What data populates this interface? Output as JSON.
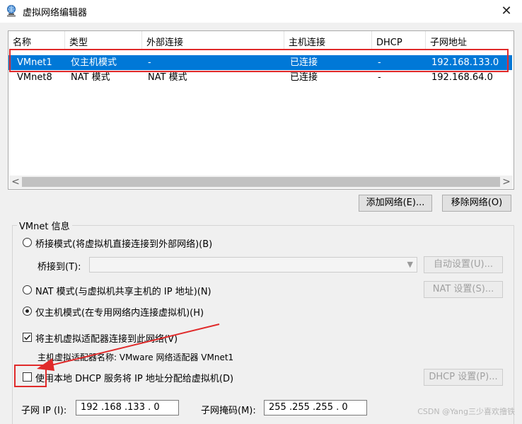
{
  "window": {
    "title": "虚拟网络编辑器",
    "close_glyph": "✕"
  },
  "table": {
    "columns": [
      "名称",
      "类型",
      "外部连接",
      "主机连接",
      "DHCP",
      "子网地址"
    ],
    "rows": [
      [
        "VMnet1",
        "仅主机模式",
        "-",
        "已连接",
        "-",
        "192.168.133.0"
      ],
      [
        "VMnet8",
        "NAT 模式",
        "NAT 模式",
        "已连接",
        "-",
        "192.168.64.0"
      ]
    ],
    "selected_row": 0,
    "scroll_left": "<",
    "scroll_right": ">"
  },
  "buttons": {
    "add_network": "添加网络(E)...",
    "remove_network": "移除网络(O)"
  },
  "vmnet_info": {
    "group_title": "VMnet 信息",
    "bridged_label": "桥接模式(将虚拟机直接连接到外部网络)(B)",
    "bridged_to_label": "桥接到(T):",
    "bridged_to_value": "",
    "auto_settings": "自动设置(U)...",
    "nat_label": "NAT 模式(与虚拟机共享主机的 IP 地址)(N)",
    "nat_settings": "NAT 设置(S)...",
    "hostonly_label": "仅主机模式(在专用网络内连接虚拟机)(H)",
    "selected_mode": "hostonly",
    "connect_adapter_label": "将主机虚拟适配器连接到此网络(V)",
    "connect_adapter_checked": true,
    "adapter_name_text": "主机虚拟适配器名称: VMware 网络适配器 VMnet1",
    "dhcp_label": "使用本地 DHCP 服务将 IP 地址分配给虚拟机(D)",
    "dhcp_checked": false,
    "dhcp_settings": "DHCP 设置(P)...",
    "subnet_ip_label": "子网 IP (I):",
    "subnet_ip_value": "192 .168 .133 . 0",
    "subnet_mask_label": "子网掩码(M):",
    "subnet_mask_value": "255 .255 .255 . 0"
  },
  "watermark": "CSDN @Yang三少喜欢撸铁",
  "colors": {
    "selection": "#0078d7",
    "annotation": "#e02a2a"
  },
  "icons": {
    "app": "network-globe-icon",
    "close": "close-icon"
  }
}
